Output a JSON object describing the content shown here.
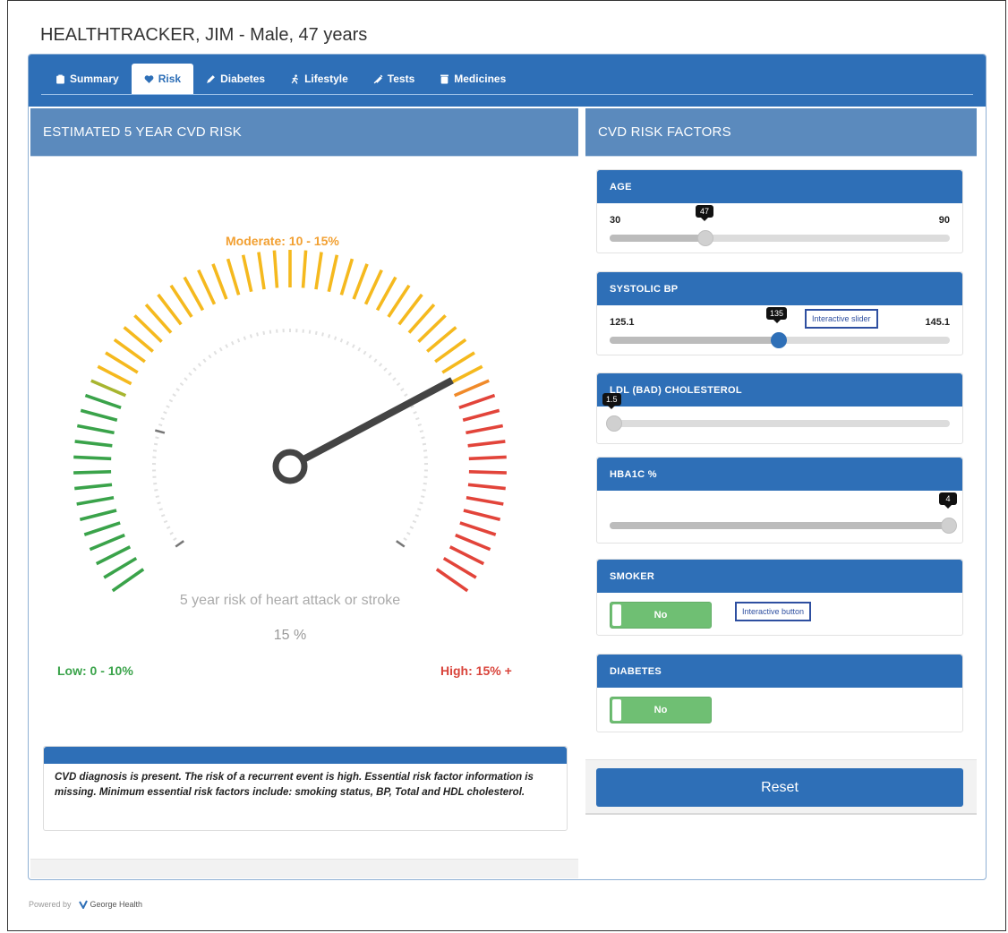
{
  "patient": {
    "title": "HEALTHTRACKER, JIM - Male, 47 years"
  },
  "tabs": [
    {
      "label": "Summary",
      "icon": "clipboard-icon"
    },
    {
      "label": "Risk",
      "icon": "heart-icon"
    },
    {
      "label": "Diabetes",
      "icon": "pencil-icon"
    },
    {
      "label": "Lifestyle",
      "icon": "running-person-icon"
    },
    {
      "label": "Tests",
      "icon": "syringe-icon"
    },
    {
      "label": "Medicines",
      "icon": "pill-bottle-icon"
    }
  ],
  "active_tab": "Risk",
  "risk_panel": {
    "title": "ESTIMATED 5 YEAR CVD RISK",
    "gauge": {
      "moderate_label": "Moderate: 10 - 15%",
      "low_label": "Low: 0 - 10%",
      "high_label": "High: 15% +",
      "caption": "5 year risk of heart attack or stroke",
      "value_text": "15 %",
      "colors": {
        "low": "#3aa34a",
        "moderate": "#f5b91e",
        "high": "#e2443a",
        "needle": "#444444"
      }
    },
    "message": "CVD diagnosis is present. The risk of a recurrent event is high. Essential risk factor information is missing. Minimum essential risk factors include: smoking status, BP, Total and HDL cholesterol."
  },
  "factors_panel": {
    "title": "CVD RISK FACTORS",
    "age": {
      "label": "AGE",
      "min": "30",
      "max": "90",
      "value": "47",
      "fraction": 0.28
    },
    "systolic_bp": {
      "label": "SYSTOLIC BP",
      "min": "125.1",
      "max": "145.1",
      "value": "135",
      "fraction": 0.5,
      "annotation": "Interactive slider"
    },
    "ldl": {
      "label": "LDL (BAD) CHOLESTEROL",
      "value": "1.5",
      "fraction": 0.0
    },
    "hba1c": {
      "label": "HBA1C %",
      "value": "4",
      "fraction": 1.0
    },
    "smoker": {
      "label": "SMOKER",
      "state": "No",
      "annotation": "Interactive button"
    },
    "diabetes": {
      "label": "DIABETES",
      "state": "No"
    },
    "reset_label": "Reset"
  },
  "footer": {
    "powered_by": "Powered by",
    "brand": "George Health"
  }
}
